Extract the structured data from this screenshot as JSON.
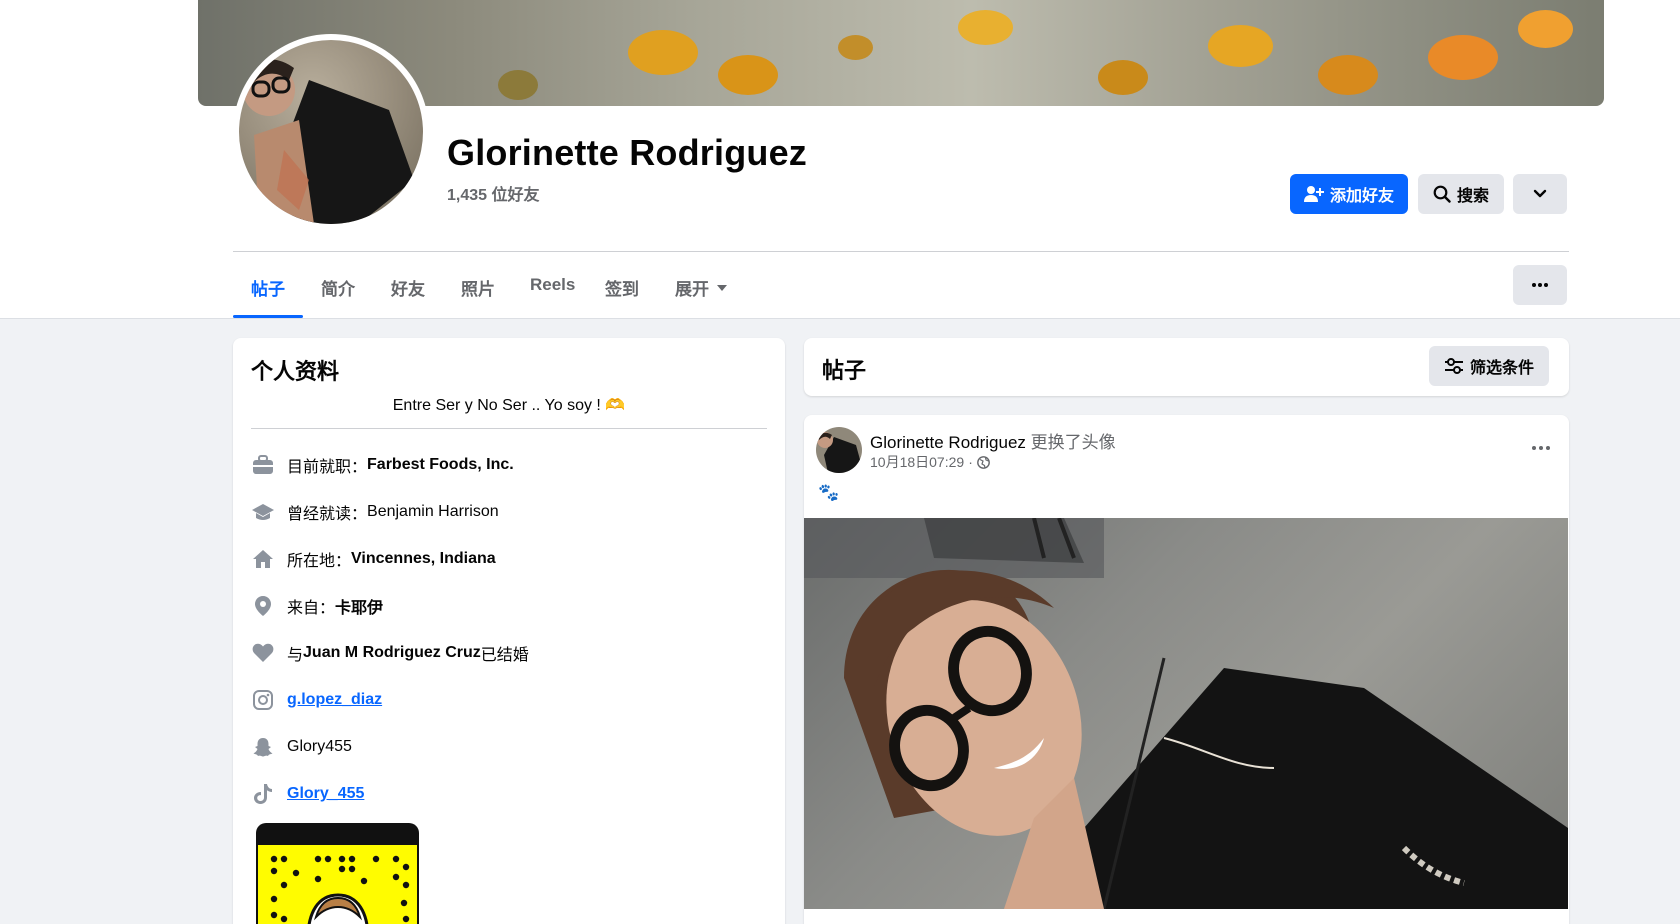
{
  "profile": {
    "name": "Glorinette Rodriguez",
    "friends_count": "1,435 位好友"
  },
  "actions": {
    "add_friend": "添加好友",
    "search": "搜索"
  },
  "tabs": [
    {
      "label": "帖子",
      "active": true
    },
    {
      "label": "简介"
    },
    {
      "label": "好友"
    },
    {
      "label": "照片"
    },
    {
      "label": "Reels"
    },
    {
      "label": "签到"
    },
    {
      "label": "展开"
    }
  ],
  "intro": {
    "title": "个人资料",
    "bio": "Entre Ser y No Ser .. Yo soy !",
    "bio_emoji": "🫶",
    "work": {
      "prefix": "目前就职：",
      "value": "Farbest Foods, Inc."
    },
    "education": {
      "prefix": "曾经就读：",
      "value": "Benjamin Harrison"
    },
    "lives": {
      "prefix": "所在地：",
      "value": "Vincennes, Indiana"
    },
    "from": {
      "prefix": "来自：",
      "value": "卡耶伊"
    },
    "relationship": {
      "prefix": "与 ",
      "value": "Juan M Rodriguez Cruz",
      "suffix": " 已结婚"
    },
    "instagram": "g.lopez_diaz",
    "snapchat": "Glory455",
    "tiktok": "Glory_455"
  },
  "posts_header": {
    "title": "帖子",
    "filter_label": "筛选条件"
  },
  "post": {
    "author": "Glorinette Rodriguez",
    "action": "更换了头像",
    "timestamp": "10月18日07:29",
    "separator": "·",
    "text": "🐾"
  },
  "colors": {
    "accent": "#0866ff",
    "secondary_text": "#65676b",
    "page_bg": "#f0f2f5",
    "button_gray": "#e4e6eb"
  },
  "icons": {
    "work": "briefcase-icon",
    "education": "graduation-cap-icon",
    "lives": "house-icon",
    "from": "location-pin-icon",
    "relationship": "heart-icon",
    "instagram": "instagram-icon",
    "snapchat": "snapchat-icon",
    "tiktok": "tiktok-icon"
  }
}
